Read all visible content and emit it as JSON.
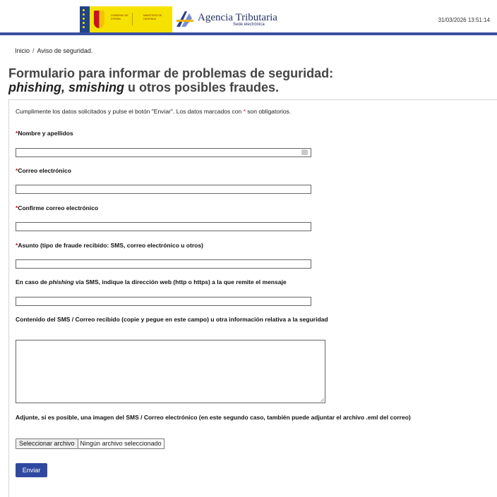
{
  "header": {
    "gov_logo": {
      "text_left": "GOBIERNO DE ESPAÑA",
      "text_right": "MINISTERIO DE HACIENDA",
      "colors": {
        "background": "#f6e200",
        "stripe": "#21438a"
      }
    },
    "agency": {
      "title": "Agencia Tributaria",
      "subtitle": "Sede electrónica",
      "logo_icon": "agencia-tributaria-logo-icon"
    },
    "datetime": "31/03/2026 13:51:14",
    "accent_color": "#3a4fa0"
  },
  "breadcrumb": {
    "home": "Inicio",
    "separator": "/",
    "current": "Aviso de seguridad."
  },
  "page": {
    "title_line1": "Formulario para informar de problemas de seguridad:",
    "title_em": "phishing, smishing",
    "title_rest": " u otros posibles fraudes."
  },
  "form": {
    "instructions_before": "Cumplimente los datos solicitados y pulse el botón \"Enviar\". Los datos marcados con ",
    "required_mark": "*",
    "instructions_after": " son obligatorios.",
    "fields": {
      "name": {
        "label": "Nombre y apellidos",
        "required": true,
        "value": ""
      },
      "email": {
        "label": "Correo electrónico",
        "required": true,
        "value": ""
      },
      "confirm_email": {
        "label": "Confirme correo electrónico",
        "required": true,
        "value": ""
      },
      "subject": {
        "label": "Asunto (tipo de fraude recibido: SMS, correo electrónico u otros)",
        "required": true,
        "value": ""
      },
      "url": {
        "label_before": "En caso de ",
        "label_em": "phishing",
        "label_after": " vía SMS, indique la dirección web (http o https) a la que remite el mensaje",
        "required": false,
        "value": ""
      },
      "content": {
        "label": "Contenido del SMS / Correo recibido  (copie y pegue en este campo) u otra información relativa a la seguridad",
        "required": false,
        "value": ""
      },
      "attachment": {
        "label": "Adjunte, si es posible, una imagen del SMS / Correo electrónico (en este segundo caso, también puede adjuntar el archivo .eml del correo)",
        "button": "Seleccionar archivo",
        "status": "Ningún archivo seleccionado"
      }
    },
    "submit": "Enviar",
    "colors": {
      "submit_bg": "#2f49a0",
      "required": "#d9001b"
    }
  }
}
